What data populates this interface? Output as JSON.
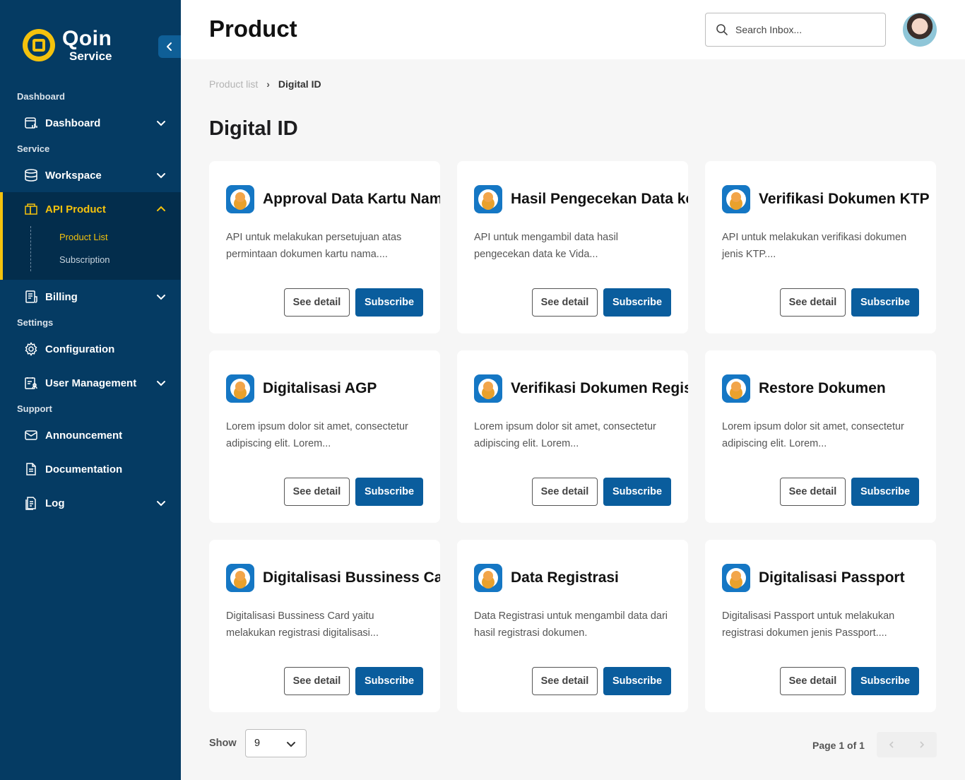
{
  "brand": {
    "name_line1": "Qoin",
    "name_line2": "Service",
    "accent": "#f4c20d",
    "sidebar_bg": "#053b63",
    "primary": "#0a5d9d"
  },
  "sidebar": {
    "sections": {
      "dashboard": "Dashboard",
      "service": "Service",
      "settings": "Settings",
      "support": "Support"
    },
    "items": [
      {
        "label": "Dashboard",
        "icon": "dashboard-icon"
      },
      {
        "label": "Workspace",
        "icon": "database-icon"
      },
      {
        "label": "API Product",
        "icon": "product-icon"
      },
      {
        "label": "Billing",
        "icon": "bill-icon"
      },
      {
        "label": "Configuration",
        "icon": "gear-icon"
      },
      {
        "label": "User Management",
        "icon": "user-list-icon"
      },
      {
        "label": "Announcement",
        "icon": "mail-icon"
      },
      {
        "label": "Documentation",
        "icon": "document-icon"
      },
      {
        "label": "Log",
        "icon": "log-icon"
      }
    ],
    "subitems": [
      {
        "label": "Product List"
      },
      {
        "label": "Subscription"
      }
    ]
  },
  "header": {
    "title": "Product",
    "search_placeholder": "Search Inbox..."
  },
  "breadcrumb": {
    "parent": "Product list",
    "current": "Digital ID"
  },
  "section_title": "Digital ID",
  "buttons": {
    "detail": "See detail",
    "subscribe": "Subscribe"
  },
  "cards": [
    {
      "title": "Approval Data Kartu Nama",
      "desc": "API untuk melakukan persetujuan atas permintaan dokumen kartu nama...."
    },
    {
      "title": "Hasil Pengecekan Data ke Vida",
      "desc": "API untuk mengambil data hasil pengecekan data ke Vida..."
    },
    {
      "title": "Verifikasi Dokumen KTP",
      "desc": "API untuk melakukan verifikasi dokumen jenis KTP...."
    },
    {
      "title": "Digitalisasi AGP",
      "desc": "Lorem ipsum dolor sit amet, consectetur adipiscing elit. Lorem..."
    },
    {
      "title": "Verifikasi Dokumen Registrasi",
      "desc": "Lorem ipsum dolor sit amet, consectetur adipiscing elit. Lorem..."
    },
    {
      "title": "Restore Dokumen",
      "desc": "Lorem ipsum dolor sit amet, consectetur adipiscing elit. Lorem..."
    },
    {
      "title": "Digitalisasi Bussiness Card",
      "desc": "Digitalisasi Bussiness Card yaitu melakukan registrasi digitalisasi..."
    },
    {
      "title": "Data Registrasi",
      "desc": "Data Registrasi untuk mengambil data dari hasil registrasi dokumen."
    },
    {
      "title": "Digitalisasi Passport",
      "desc": "Digitalisasi Passport untuk melakukan registrasi dokumen jenis Passport...."
    }
  ],
  "footer": {
    "show_label": "Show",
    "show_value": "9",
    "page_info": "Page 1 of 1"
  }
}
